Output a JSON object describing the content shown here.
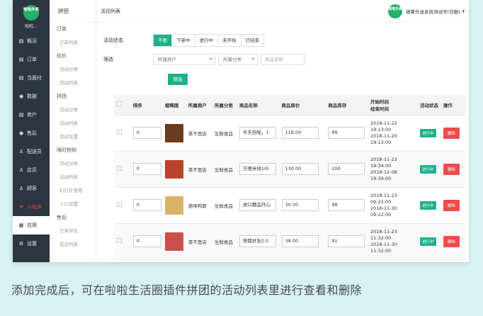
{
  "sidebar": {
    "logo_text": "啦啦外卖",
    "shop_name": "啦啦...",
    "items": [
      {
        "icon": "▤",
        "label": "概况"
      },
      {
        "icon": "▤",
        "label": "订单"
      },
      {
        "icon": "▤",
        "label": "当面付"
      },
      {
        "icon": "◉",
        "label": "数据"
      },
      {
        "icon": "▤",
        "label": "商户"
      },
      {
        "icon": "◉",
        "label": "售后"
      },
      {
        "icon": "♙",
        "label": "配送员"
      },
      {
        "icon": "♙",
        "label": "店员"
      },
      {
        "icon": "♙",
        "label": "顾客"
      },
      {
        "icon": "❖",
        "label": "小程序"
      },
      {
        "icon": "▦",
        "label": "应用"
      },
      {
        "icon": "⚙",
        "label": "设置"
      }
    ]
  },
  "subnav": {
    "title": "拼团",
    "groups": [
      {
        "label": "订单",
        "items": [
          "订单列表"
        ]
      },
      {
        "label": "砍价",
        "items": [
          "活动分类",
          "活动列表"
        ]
      },
      {
        "label": "拼团",
        "items": [
          "活动分类",
          "活动列表",
          "活动设置"
        ]
      },
      {
        "label": "限时抢购",
        "items": [
          "活动分类",
          "活动列表"
        ]
      },
      {
        "label": "",
        "items": [
          "幻灯片管理",
          "入口设置"
        ]
      },
      {
        "label": "售后",
        "items": [
          "订单评论",
          "投诉列表"
        ]
      }
    ]
  },
  "topbar": {
    "breadcrumb": "活动列表",
    "avatar_text": "啦啦外卖",
    "account": "微擎外送系统测试号(勿删)"
  },
  "filters": {
    "status_label": "活动状态",
    "status_options": [
      "不限",
      "下架中",
      "进行中",
      "未开始",
      "已结束"
    ],
    "filter_label": "筛选",
    "merchant_placeholder": "所属商户",
    "category_placeholder": "所属分类",
    "name_placeholder": "商品名称",
    "filter_button": "筛选"
  },
  "table": {
    "headers": [
      "排序",
      "缩略图",
      "所属商户",
      "所属分类",
      "商品名称",
      "商品原价",
      "商品库存",
      "开始时间\n结束时间",
      "活动状态",
      "操作"
    ],
    "rows": [
      {
        "sort": "0",
        "thumb": "#6b3a1f",
        "merchant": "茶不思店",
        "category": "生鲜食品",
        "name": "冬天到啦，1",
        "price": "118.00",
        "stock": "99",
        "start": "2018-11-22",
        "start_t": "19:13:00",
        "end": "2018-11-29",
        "end_t": "19:13:00",
        "status": "进行中",
        "action": "删除"
      },
      {
        "sort": "0",
        "thumb": "#b8432a",
        "merchant": "茶不思店",
        "category": "生鲜食品",
        "name": "方便米线10(",
        "price": "130.00",
        "stock": "100",
        "start": "2018-11-22",
        "start_t": "19:34:00",
        "end": "2018-12-08",
        "end_t": "19:34:00",
        "status": "进行中",
        "action": "删除"
      },
      {
        "sort": "0",
        "thumb": "#d9b26a",
        "merchant": "绝味鸭脖",
        "category": "生鲜食品",
        "name": "进口糯品开心",
        "price": "30.00",
        "stock": "98",
        "start": "2018-11-23",
        "start_t": "09:22:00",
        "end": "2018-11-30",
        "end_t": "09:22:00",
        "status": "进行中",
        "action": "删除"
      },
      {
        "sort": "0",
        "thumb": "#c8504a",
        "merchant": "茶不思店",
        "category": "生鲜食品",
        "name": "快我好友0.0",
        "price": "38.00",
        "stock": "91",
        "start": "2018-11-23",
        "start_t": "11:32:00",
        "end": "2018-11-30",
        "end_t": "11:32:00",
        "status": "进行中",
        "action": "删除"
      }
    ]
  },
  "caption": "添加完成后，可在啦啦生活圈插件拼团的活动列表里进行查看和删除",
  "colors": {
    "sidebar": "#2c3540",
    "accent": "#1fb08a",
    "danger": "#ec4c4c"
  }
}
